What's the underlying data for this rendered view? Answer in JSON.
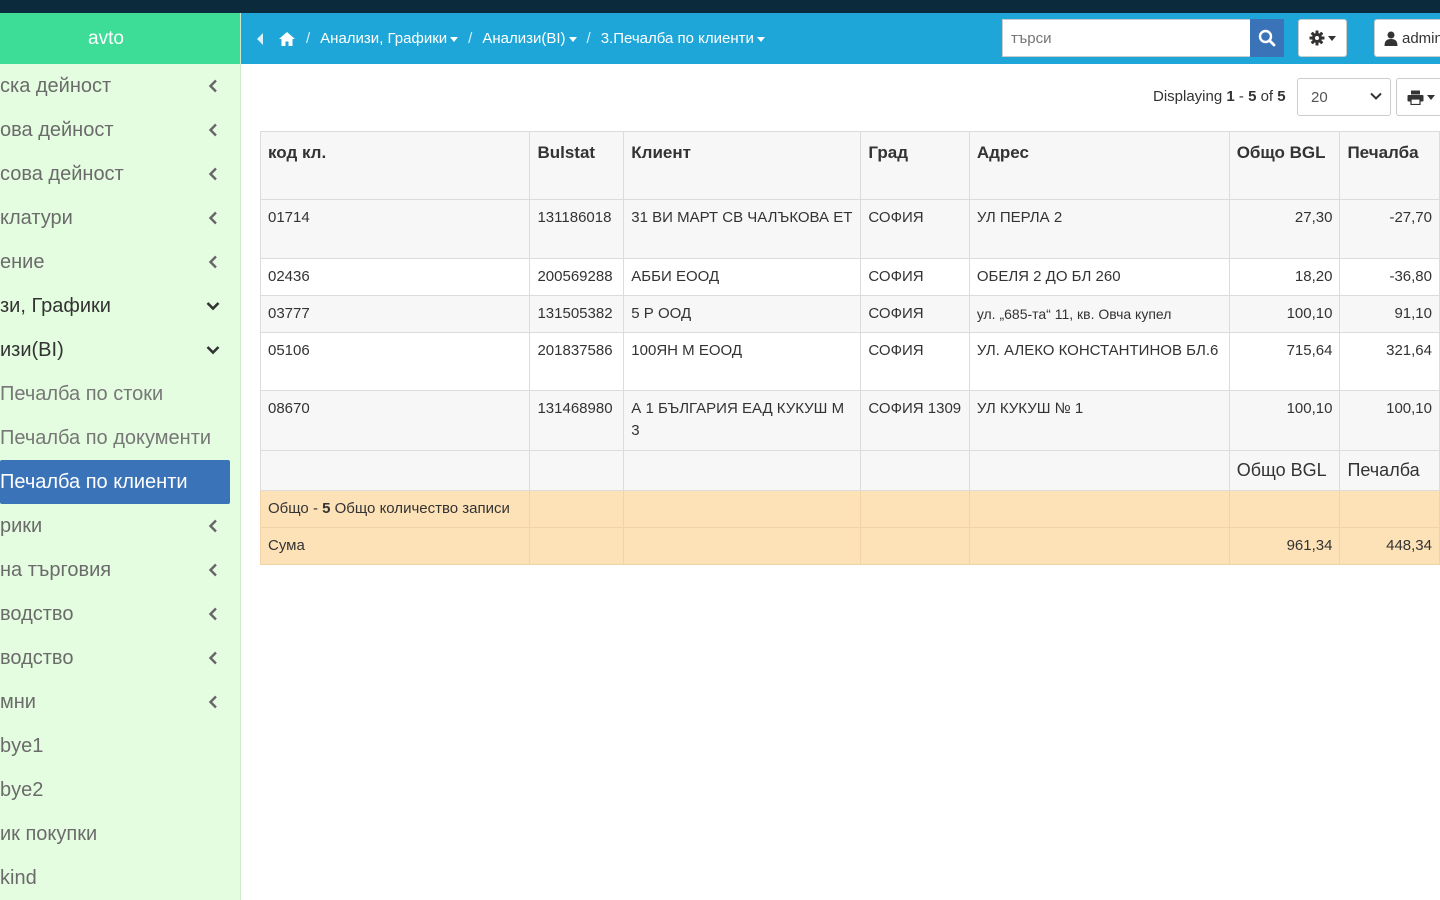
{
  "app": {
    "brand": "avto"
  },
  "sidebar": {
    "items": [
      {
        "label": "ска дейност",
        "state": "collapsed"
      },
      {
        "label": "ова дейност",
        "state": "collapsed"
      },
      {
        "label": "сова дейност",
        "state": "collapsed"
      },
      {
        "label": "клатури",
        "state": "collapsed"
      },
      {
        "label": "ение",
        "state": "collapsed"
      },
      {
        "label": "зи, Графики",
        "state": "expanded"
      },
      {
        "label": "изи(BI)",
        "state": "expanded"
      },
      {
        "label": "Печалба по стоки",
        "state": "sub"
      },
      {
        "label": "Печалба по документи",
        "state": "sub"
      },
      {
        "label": "Печалба по клиенти",
        "state": "active"
      },
      {
        "label": "рики",
        "state": "collapsed"
      },
      {
        "label": "на търговия",
        "state": "collapsed"
      },
      {
        "label": "водство",
        "state": "collapsed"
      },
      {
        "label": "водство",
        "state": "collapsed"
      },
      {
        "label": "мни",
        "state": "collapsed"
      },
      {
        "label": "bye1",
        "state": "leaf"
      },
      {
        "label": "bye2",
        "state": "leaf"
      },
      {
        "label": "ик покупки",
        "state": "leaf"
      },
      {
        "label": "kind",
        "state": "leaf"
      }
    ]
  },
  "breadcrumb": {
    "items": [
      "Анализи, Графики",
      "Анализи(BI)",
      "3.Печалба по клиенти"
    ],
    "separator": "/"
  },
  "search": {
    "placeholder": "търси",
    "value": ""
  },
  "user": {
    "name": "admin"
  },
  "pager": {
    "prefix": "Displaying",
    "from": "1",
    "dash": "-",
    "to": "5",
    "of": "of",
    "total": "5",
    "per_page": "20"
  },
  "table": {
    "columns": [
      "код кл.",
      "Bulstat",
      "Клиент",
      "Град",
      "Адрес",
      "Общо BGL",
      "Печалба"
    ],
    "rows": [
      [
        "01714",
        "131186018",
        "31 ВИ МАРТ СВ ЧАЛЪКОВА ЕТ",
        "СОФИЯ",
        "УЛ ПЕРЛА 2",
        "27,30",
        "-27,70"
      ],
      [
        "02436",
        "200569288",
        "АББИ ЕООД",
        "СОФИЯ",
        "ОБЕЛЯ 2 ДО БЛ 260",
        "18,20",
        "-36,80"
      ],
      [
        "03777",
        "131505382",
        "5 Р ООД",
        "СОФИЯ",
        "ул. „685-та“ 11, кв. Овча купел",
        "100,10",
        "91,10"
      ],
      [
        "05106",
        "201837586",
        "100ЯН М ЕООД",
        "СОФИЯ",
        "УЛ. АЛЕКО КОНСТАНТИНОВ БЛ.6",
        "715,64",
        "321,64"
      ],
      [
        "08670",
        "131468980",
        "А 1 БЪЛГАРИЯ ЕАД КУКУШ М 3",
        "СОФИЯ 1309",
        "УЛ КУКУШ № 1",
        "100,10",
        "100,10"
      ]
    ],
    "footer_labels": [
      "Общо BGL",
      "Печалба"
    ],
    "summary": {
      "count_prefix": "Общо -",
      "count": "5",
      "count_suffix": "Общо количество записи",
      "sum_label": "Сума",
      "sum_total": "961,34",
      "sum_profit": "448,34"
    }
  },
  "colors": {
    "header": "#1fa6d8",
    "brand": "#3ddc97",
    "sidebar": "#e4fde0",
    "active": "#3b73b9",
    "summary": "#fde2b8"
  }
}
